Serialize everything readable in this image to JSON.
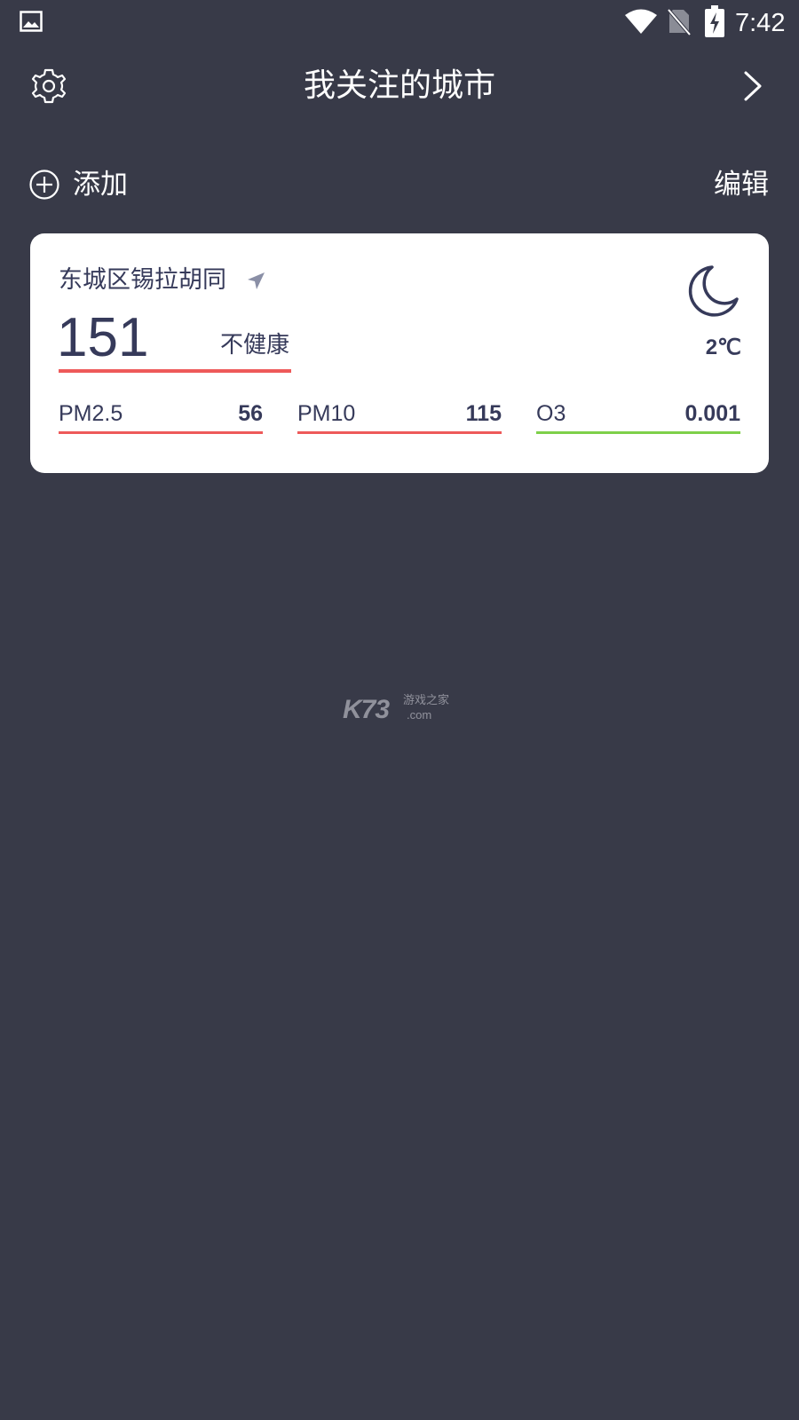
{
  "status_bar": {
    "time": "7:42",
    "icons": [
      "gallery-icon",
      "wifi-icon",
      "no-sim-icon",
      "battery-charging-icon"
    ]
  },
  "header": {
    "title": "我关注的城市",
    "left_icon": "gear-icon",
    "right_icon": "chevron-right-icon"
  },
  "toolbar": {
    "add_label": "添加",
    "add_icon": "plus-circle-icon",
    "edit_label": "编辑"
  },
  "city_card": {
    "city": "东城区锡拉胡同",
    "location_icon": "location-arrow-icon",
    "aqi": "151",
    "level": "不健康",
    "weather_icon": "moon-icon",
    "temperature": "2℃",
    "pollutants": [
      {
        "label": "PM2.5",
        "value": "56",
        "color": "#ee5a5a"
      },
      {
        "label": "PM10",
        "value": "115",
        "color": "#ee5a5a"
      },
      {
        "label": "O3",
        "value": "0.001",
        "color": "#7ed04a"
      }
    ],
    "aqi_color": "#ee5a5a"
  },
  "watermark": {
    "brand": "K73",
    "cn": "游戏之家",
    "domain": ".com"
  },
  "colors": {
    "background": "#383a48",
    "card": "#ffffff",
    "text_dark": "#363a5a"
  }
}
